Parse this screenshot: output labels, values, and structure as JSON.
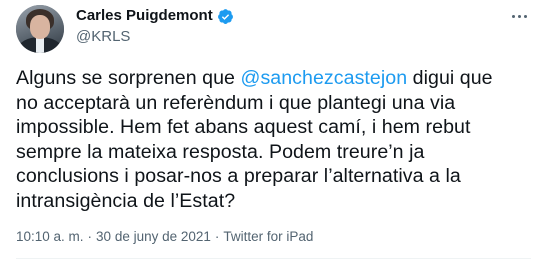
{
  "author": {
    "display_name": "Carles Puigdemont",
    "handle": "@KRLS",
    "verified": true,
    "avatar_icon": "profile-photo"
  },
  "tweet": {
    "text_before": "Alguns se sorprenen que ",
    "mention": "@sanchezcastejon",
    "text_after": " digui que no acceptarà un referèndum i que plantegi una via impossible. Hem fet abans aquest camí, i hem rebut sempre la mateixa resposta. Podem treure’n ja conclusions i posar-nos a preparar l’alternativa a la intransigència de l’Estat?"
  },
  "meta": {
    "time": "10:10 a. m.",
    "separator": "·",
    "date": "30 de juny de 2021",
    "source": "Twitter for iPad"
  },
  "icons": {
    "verified": "verified-badge-icon",
    "more": "more-options-icon"
  },
  "colors": {
    "link": "#1d9bf0",
    "text": "#0f1419",
    "secondary": "#536471",
    "verified": "#1d9bf0"
  }
}
